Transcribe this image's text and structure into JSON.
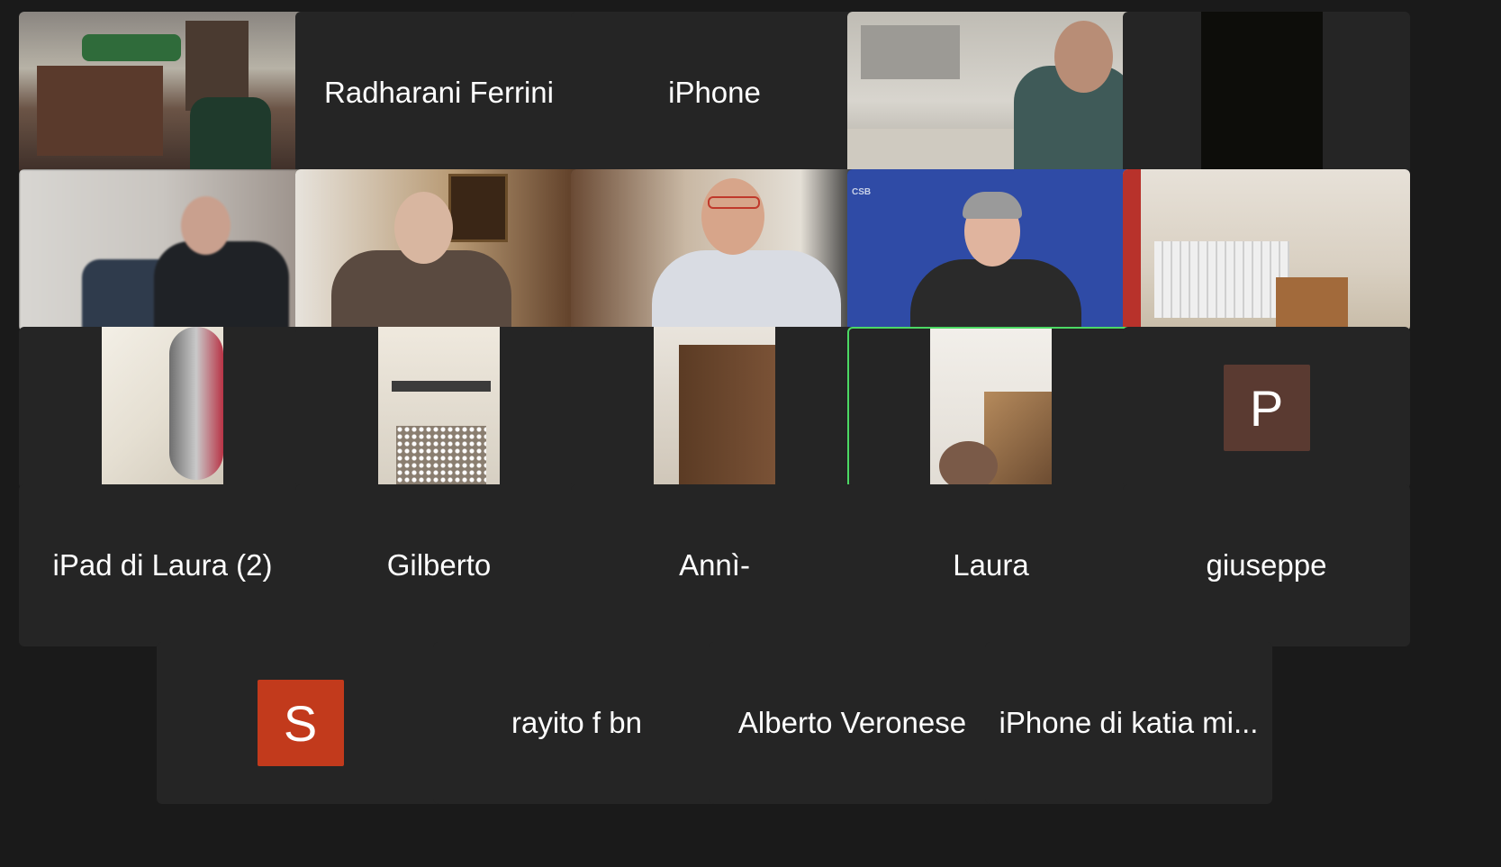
{
  "colors": {
    "background": "#1a1a1a",
    "tile": "#252525",
    "active_border": "#4cd964",
    "avatar_p": "#5a3a31",
    "avatar_s": "#c23a1c"
  },
  "participants": [
    {
      "kind": "video",
      "scene": "kitchen-wide"
    },
    {
      "kind": "name",
      "name": "Radharani Ferrini"
    },
    {
      "kind": "name",
      "name": "iPhone"
    },
    {
      "kind": "video",
      "scene": "man-kitchen"
    },
    {
      "kind": "video",
      "scene": "dark-portrait"
    },
    {
      "kind": "video",
      "scene": "blurred-man"
    },
    {
      "kind": "video",
      "scene": "woman-glasses-living"
    },
    {
      "kind": "video",
      "scene": "woman-kitchen"
    },
    {
      "kind": "video",
      "scene": "woman-csb-backdrop",
      "backdrop_text": "CSB"
    },
    {
      "kind": "video",
      "scene": "radiator-wall"
    },
    {
      "kind": "video",
      "scene": "portrait-appliance"
    },
    {
      "kind": "video",
      "scene": "portrait-window"
    },
    {
      "kind": "video",
      "scene": "portrait-cabinet"
    },
    {
      "kind": "video",
      "scene": "portrait-ceiling-face",
      "active": true
    },
    {
      "kind": "avatar",
      "initial": "P"
    },
    {
      "kind": "name",
      "name": "iPad di Laura (2)"
    },
    {
      "kind": "name",
      "name": "Gilberto"
    },
    {
      "kind": "name",
      "name": "Annì-"
    },
    {
      "kind": "name",
      "name": "Laura"
    },
    {
      "kind": "name",
      "name": "giuseppe"
    },
    {
      "kind": "avatar",
      "initial": "S"
    },
    {
      "kind": "name",
      "name": "rayito f bn"
    },
    {
      "kind": "name",
      "name": "Alberto Veronese"
    },
    {
      "kind": "name",
      "name": "iPhone di katia mi..."
    }
  ]
}
